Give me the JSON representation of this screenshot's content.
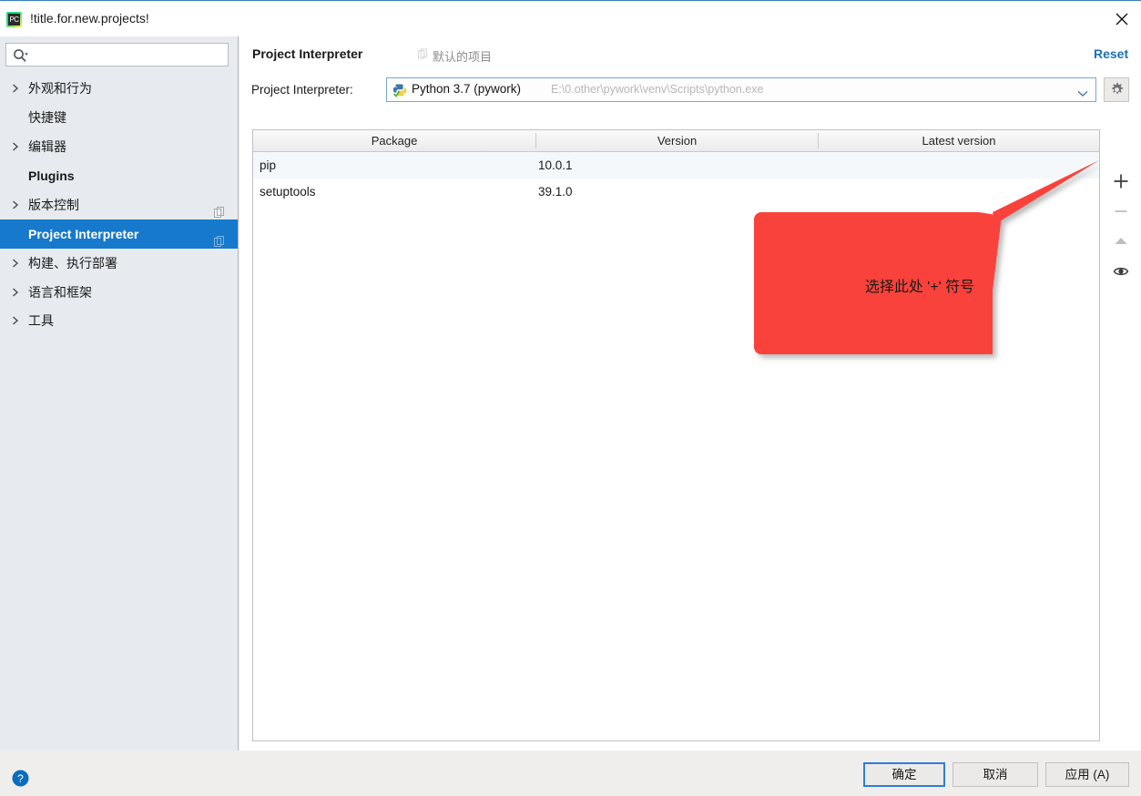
{
  "window": {
    "title": "!title.for.new.projects!",
    "app_icon": "pycharm-icon",
    "app_icon_text": "PC",
    "close_icon": "close-icon"
  },
  "sidebar": {
    "search": {
      "value": "",
      "placeholder": "",
      "icon": "search-icon"
    },
    "items": [
      {
        "label": "外观和行为",
        "expandable": true,
        "selected": false,
        "bold": false,
        "copy_icon": false
      },
      {
        "label": "快捷键",
        "expandable": false,
        "selected": false,
        "bold": false,
        "copy_icon": false
      },
      {
        "label": "编辑器",
        "expandable": true,
        "selected": false,
        "bold": false,
        "copy_icon": false
      },
      {
        "label": "Plugins",
        "expandable": false,
        "selected": false,
        "bold": true,
        "copy_icon": false
      },
      {
        "label": "版本控制",
        "expandable": true,
        "selected": false,
        "bold": false,
        "copy_icon": true
      },
      {
        "label": "Project Interpreter",
        "expandable": false,
        "selected": true,
        "bold": true,
        "copy_icon": true
      },
      {
        "label": "构建、执行部署",
        "expandable": true,
        "selected": false,
        "bold": false,
        "copy_icon": false
      },
      {
        "label": "语言和框架",
        "expandable": true,
        "selected": false,
        "bold": false,
        "copy_icon": false
      },
      {
        "label": "工具",
        "expandable": true,
        "selected": false,
        "bold": false,
        "copy_icon": false
      }
    ]
  },
  "main": {
    "pane_title": "Project Interpreter",
    "scope_label": "默认的项目",
    "scope_icon": "project-scope-icon",
    "reset_label": "Reset",
    "interpreter": {
      "field_label": "Project Interpreter:",
      "icon": "python-icon",
      "name": "Python 3.7 (pywork)",
      "path": "E:\\0.other\\pywork\\venv\\Scripts\\python.exe",
      "dropdown_icon": "chevron-down-icon",
      "settings_icon": "gear-icon"
    },
    "table": {
      "columns": [
        "Package",
        "Version",
        "Latest version"
      ],
      "rows": [
        {
          "package": "pip",
          "version": "10.0.1",
          "latest": ""
        },
        {
          "package": "setuptools",
          "version": "39.1.0",
          "latest": ""
        }
      ]
    },
    "toolbar": [
      {
        "name": "add-package-button",
        "icon": "plus-icon",
        "enabled": true
      },
      {
        "name": "remove-package-button",
        "icon": "minus-icon",
        "enabled": false
      },
      {
        "name": "upgrade-package-button",
        "icon": "arrow-up-icon",
        "enabled": false
      },
      {
        "name": "show-early-releases-button",
        "icon": "eye-icon",
        "enabled": true
      }
    ]
  },
  "annotation": {
    "text": "选择此处 '+' 符号",
    "color": "#f9423a"
  },
  "footer": {
    "help_icon": "help-icon",
    "buttons": [
      {
        "label": "确定",
        "default": true
      },
      {
        "label": "取消",
        "default": false
      },
      {
        "label": "应用 (A)",
        "default": false
      }
    ]
  }
}
